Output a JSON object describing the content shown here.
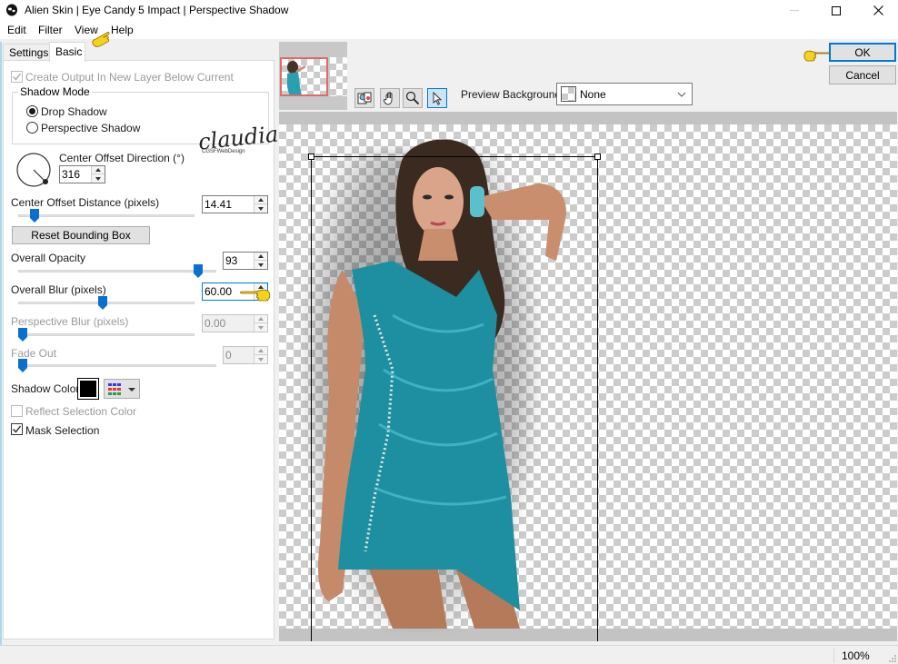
{
  "window": {
    "title": "Alien Skin | Eye Candy 5 Impact | Perspective Shadow",
    "controls": [
      "minimize",
      "maximize",
      "close"
    ]
  },
  "menu": [
    "Edit",
    "Filter",
    "View",
    "Help"
  ],
  "tabs": [
    {
      "label": "Settings",
      "active": false
    },
    {
      "label": "Basic",
      "active": true
    }
  ],
  "basic": {
    "create_output_label": "Create Output In New Layer Below Current",
    "create_output_checked": true,
    "create_output_disabled": true,
    "shadow_mode": {
      "title": "Shadow Mode",
      "options": [
        "Drop Shadow",
        "Perspective Shadow"
      ],
      "selected": "Drop Shadow"
    },
    "center_offset_direction": {
      "label": "Center Offset Direction (°)",
      "value": "316"
    },
    "center_offset_distance": {
      "label": "Center Offset Distance (pixels)",
      "value": "14.41",
      "slider_fraction": 0.07
    },
    "reset_button": "Reset Bounding Box",
    "overall_opacity": {
      "label": "Overall Opacity",
      "value": "93",
      "slider_fraction": 0.93
    },
    "overall_blur": {
      "label": "Overall Blur (pixels)",
      "value": "60.00",
      "slider_fraction": 0.48
    },
    "perspective_blur": {
      "label": "Perspective Blur (pixels)",
      "value": "0.00",
      "disabled": true,
      "slider_fraction": 0
    },
    "fade_out": {
      "label": "Fade Out",
      "value": "0",
      "disabled": true,
      "slider_fraction": 0
    },
    "shadow_color": {
      "label": "Shadow Color",
      "color": "#000000"
    },
    "reflect_selection_color": {
      "label": "Reflect Selection Color",
      "checked": false,
      "disabled": true
    },
    "mask_selection": {
      "label": "Mask Selection",
      "checked": true
    }
  },
  "watermark": {
    "name": "claudia",
    "sub": "CGSFWebDesign"
  },
  "preview_toolbar": {
    "tools": [
      "preview-toggle",
      "hand-tool",
      "zoom-tool",
      "arrow-tool"
    ],
    "active_tool": "arrow-tool",
    "background_label": "Preview Background:",
    "background_value": "None"
  },
  "actions": {
    "ok": "OK",
    "cancel": "Cancel"
  },
  "status": {
    "zoom": "100%"
  },
  "colors": {
    "accent": "#0078d7",
    "thumb_frame": "#e06a6a",
    "slider_thumb": "#0a6fcf",
    "dress": "#1e8fa0"
  }
}
